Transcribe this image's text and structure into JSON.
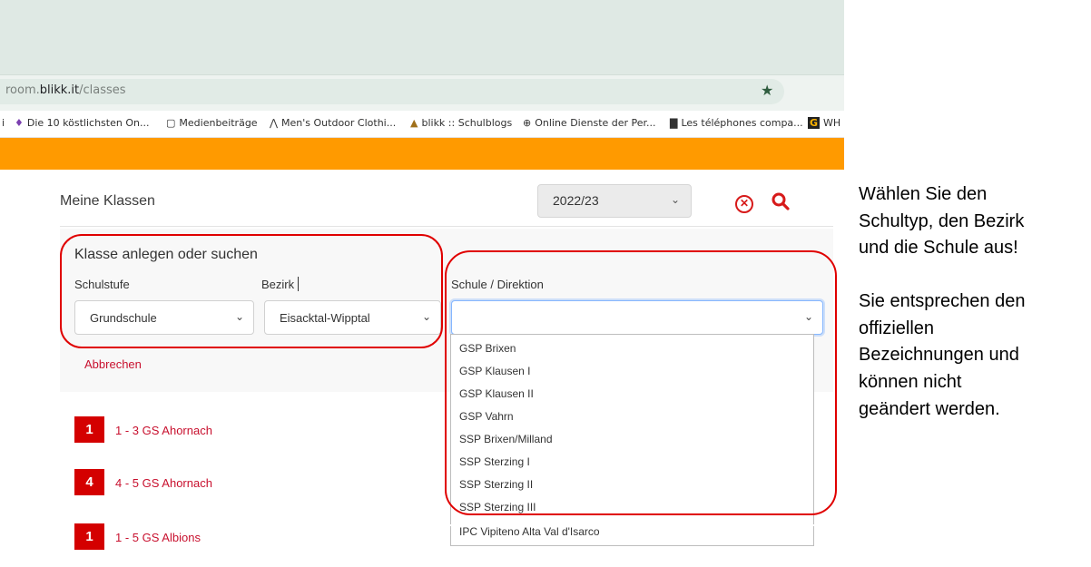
{
  "browser": {
    "url_prefix": "room.",
    "url_domain": "blikk.it",
    "url_path": "/classes",
    "bookmarks": [
      {
        "icon": "ı",
        "label": "i"
      },
      {
        "icon": "♦",
        "label": "Die 10 köstlichsten On..."
      },
      {
        "icon": "▢",
        "label": "Medienbeiträge"
      },
      {
        "icon": "⋀",
        "label": "Men's Outdoor Clothi..."
      },
      {
        "icon": "▲",
        "label": "blikk :: Schulblogs"
      },
      {
        "icon": "⊕",
        "label": "Online Dienste der Per..."
      },
      {
        "icon": "▇",
        "label": "Les téléphones compa..."
      },
      {
        "icon": "G",
        "label": "WH"
      }
    ]
  },
  "header": {
    "title": "Meine Klassen",
    "year": "2022/23"
  },
  "form": {
    "title": "Klasse anlegen oder suchen",
    "schulstufe_label": "Schulstufe",
    "schulstufe_value": "Grundschule",
    "bezirk_label": "Bezirk",
    "bezirk_value": "Eisacktal-Wipptal",
    "schule_label": "Schule / Direktion",
    "schule_value": "",
    "cancel_label": "Abbrechen"
  },
  "schule_options": [
    "GSP Brixen",
    "GSP Klausen I",
    "GSP Klausen II",
    "GSP Vahrn",
    "SSP Brixen/Milland",
    "SSP Sterzing I",
    "SSP Sterzing II",
    "SSP Sterzing III",
    "IPC Vipiteno Alta Val d'Isarco"
  ],
  "classes": [
    {
      "badge": "1",
      "name": "1 - 3 GS Ahornach"
    },
    {
      "badge": "4",
      "name": "4 - 5 GS Ahornach"
    },
    {
      "badge": "1",
      "name": "1 - 5 GS Albions"
    }
  ],
  "notes": {
    "note1": [
      "Wählen Sie den",
      "Schultyp, den Bezirk",
      "und die Schule aus!"
    ],
    "note2": [
      "Sie entsprechen den",
      "offiziellen",
      "Bezeichnungen und",
      "können nicht",
      "geändert werden."
    ]
  },
  "colors": {
    "accent_red": "#d40000",
    "orange_bar": "#ff9a00",
    "highlight": "#e00000"
  }
}
